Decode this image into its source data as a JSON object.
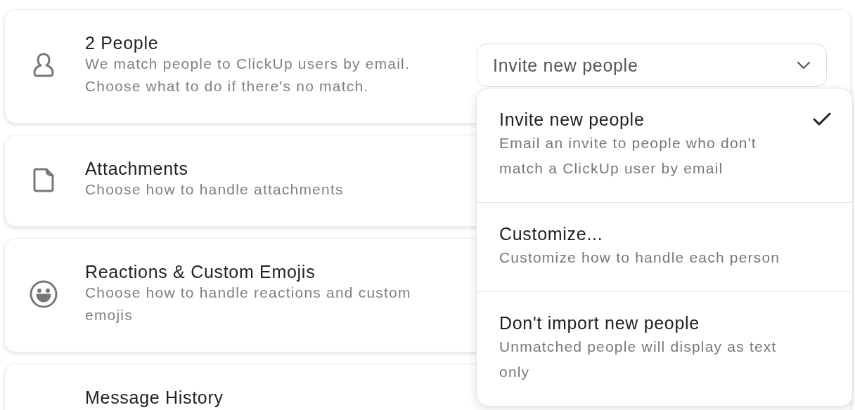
{
  "cards": [
    {
      "kind": "person",
      "title": "2 People",
      "description": "We match people to ClickUp users by email.\nChoose what to do if there's no match.",
      "dropdown": {
        "value": "Invite new people",
        "expanded": true,
        "options": [
          {
            "label": "Invite new people",
            "description": "Email an invite to people who don't match a ClickUp user by email",
            "selected": true
          },
          {
            "label": "Customize...",
            "description": "Customize how to handle each person",
            "selected": false
          },
          {
            "label": "Don't import new people",
            "description": "Unmatched people will display as text only",
            "selected": false
          }
        ]
      }
    },
    {
      "kind": "file",
      "title": "Attachments",
      "description": "Choose how to handle attachments"
    },
    {
      "kind": "emoji",
      "title": "Reactions & Custom Emojis",
      "description": "Choose how to handle reactions and custom emojis"
    },
    {
      "title": "Message History"
    }
  ]
}
